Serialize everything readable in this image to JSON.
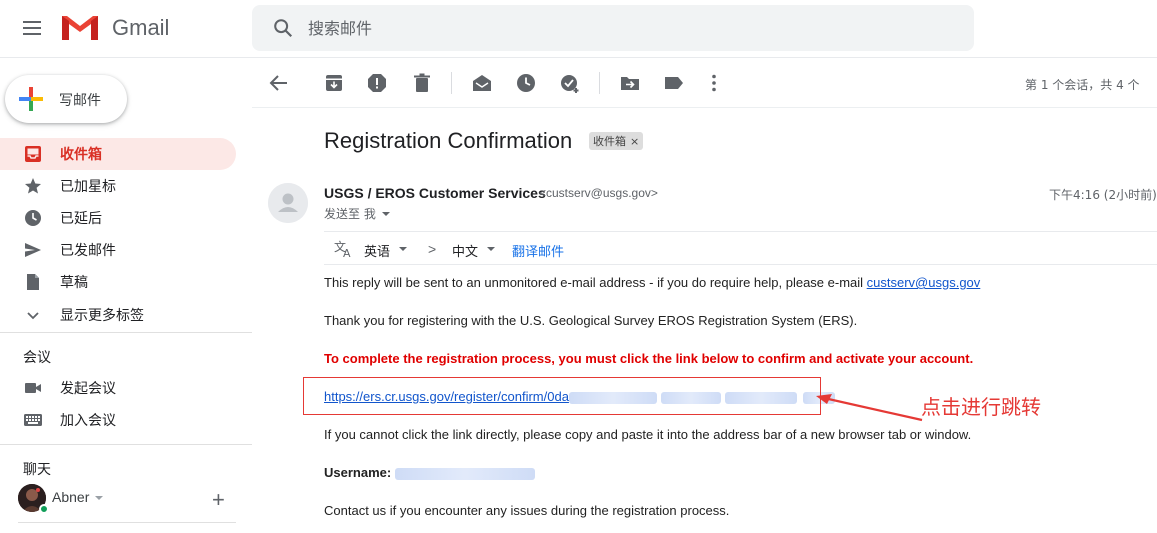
{
  "app": {
    "name": "Gmail",
    "menu_icon": "hamburger-menu-icon",
    "logo_colors": [
      "#ea4335",
      "#c5221f"
    ]
  },
  "search": {
    "placeholder": "搜索邮件",
    "icon": "search-icon"
  },
  "sidebar": {
    "compose_label": "写邮件",
    "items": [
      {
        "label": "收件箱",
        "icon": "inbox-icon",
        "active": true
      },
      {
        "label": "已加星标",
        "icon": "star-icon",
        "active": false
      },
      {
        "label": "已延后",
        "icon": "clock-icon",
        "active": false
      },
      {
        "label": "已发邮件",
        "icon": "send-icon",
        "active": false
      },
      {
        "label": "草稿",
        "icon": "draft-icon",
        "active": false
      },
      {
        "label": "显示更多标签",
        "icon": "chevron-down-icon",
        "active": false
      }
    ],
    "meet": {
      "heading": "会议",
      "items": [
        {
          "label": "发起会议",
          "icon": "video-camera-icon"
        },
        {
          "label": "加入会议",
          "icon": "keyboard-icon"
        }
      ]
    },
    "chat": {
      "heading": "聊天",
      "user": "Abner"
    }
  },
  "toolbar": {
    "buttons": [
      "back-arrow-icon",
      "archive-icon",
      "report-spam-icon",
      "delete-icon",
      "mark-unread-icon",
      "snooze-icon",
      "add-task-icon",
      "move-to-icon",
      "label-icon",
      "more-vert-icon"
    ],
    "pager": "第 1 个会话，共 4 个"
  },
  "email": {
    "subject": "Registration Confirmation",
    "label_chip": "收件箱",
    "sender_name": "USGS / EROS Customer Services",
    "sender_email": "<custserv@usgs.gov>",
    "sent_to": "发送至 我",
    "timestamp": "下午4:16 (2小时前)",
    "translate": {
      "from": "英语",
      "arrow": ">",
      "to": "中文",
      "link": "翻译邮件"
    },
    "lines": {
      "l1_text": "This reply will be sent to an unmonitored e-mail address - if you do require help, please e-mail ",
      "l1_link": "custserv@usgs.gov",
      "l2": "Thank you for registering with the U.S. Geological Survey EROS Registration System (ERS).",
      "l3": "To complete the registration process, you must click the link below to confirm and activate your account.",
      "link_prefix": "https://ers.cr.usgs.gov/register/confirm/0da",
      "l5": "If you cannot click the link directly, please copy and paste it into the address bar of a new browser tab or window.",
      "username_label": "Username:",
      "l7": "Contact us if you encounter any issues during the registration process."
    },
    "annotation": "点击进行跳转",
    "annotation_color": "#e53935",
    "link_color": "#1155cc",
    "red_text_color": "#e00000"
  }
}
